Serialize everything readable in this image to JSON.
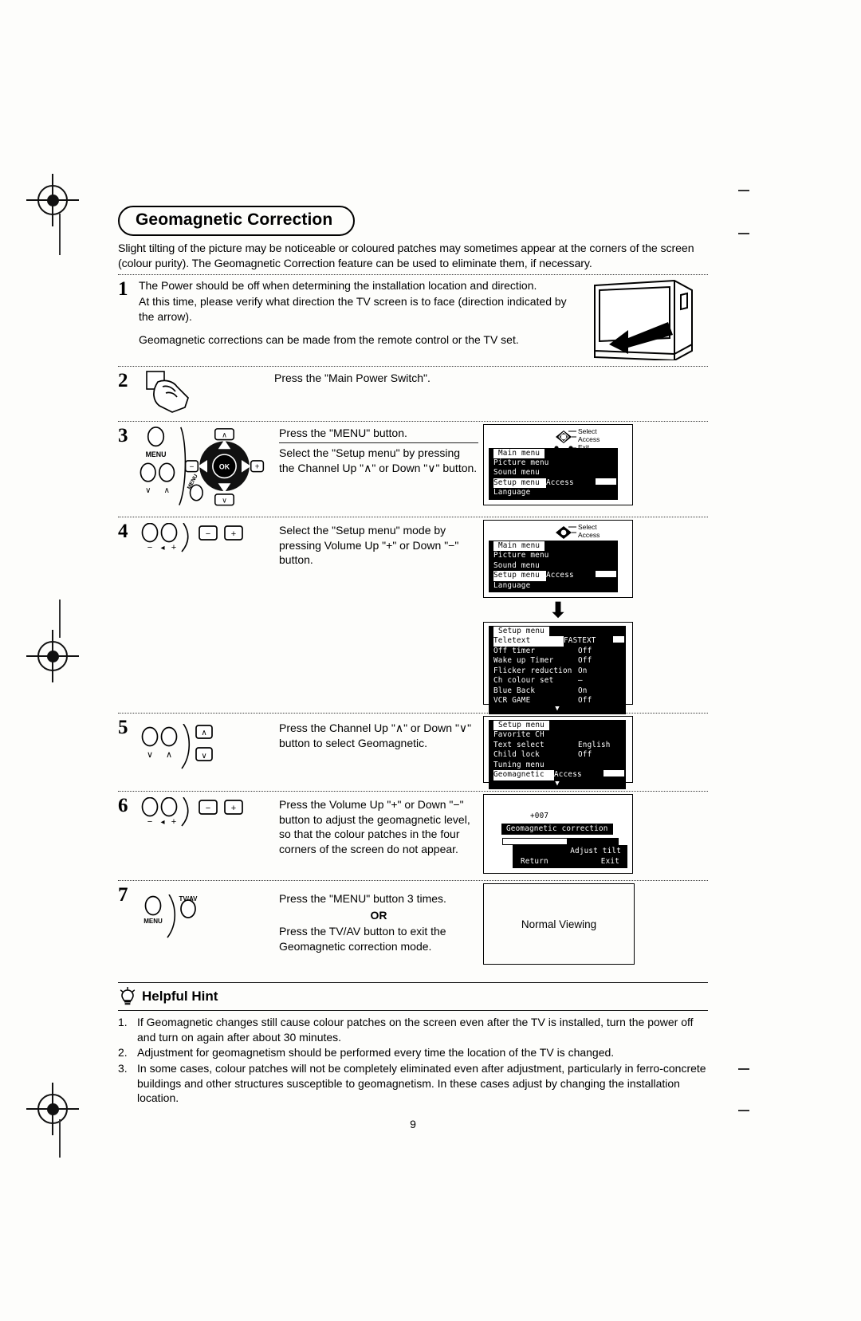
{
  "document": {
    "page_number": "9",
    "section_title": "Geomagnetic Correction",
    "intro": "Slight tilting of the picture may be noticeable or coloured patches may sometimes appear at the corners of the screen (colour purity). The Geomagnetic Correction feature can be used to eliminate them, if necessary."
  },
  "steps": [
    {
      "number": "1",
      "lines": [
        "The Power should be off when determining the installation location and direction.",
        "At this time, please verify what direction the TV screen is to face (direction indicated by the arrow).",
        "Geomagnetic corrections can be made from the remote control or the TV set."
      ],
      "art": "tv-set-with-direction-arrow"
    },
    {
      "number": "2",
      "text": "Press the \"Main Power Switch\".",
      "art": "hand-pressing-switch"
    },
    {
      "number": "3",
      "text_top": "Press the \"MENU\" button.",
      "text_bottom": "Select the \"Setup menu\" by pressing the Channel Up \"∧\" or Down \"∨\" button.",
      "art": "remote-menu-and-dpad",
      "remote_labels": {
        "menu": "MENU",
        "menu_small": "MENU",
        "ok": "OK",
        "minus": "−",
        "plus": "+",
        "up": "∧",
        "down": "∨"
      }
    },
    {
      "number": "4",
      "text": "Select the \"Setup menu\" mode by pressing Volume Up \"+\" or Down \"−\" button.",
      "art": "remote-volume-buttons"
    },
    {
      "number": "5",
      "text": "Press the Channel Up \"∧\" or Down \"∨\" button to select Geomagnetic.",
      "art": "remote-channel-buttons"
    },
    {
      "number": "6",
      "text": "Press the Volume Up \"+\" or Down \"−\" button to adjust the geomagnetic level, so that the colour patches in the four corners of the screen do not appear.",
      "art": "remote-volume-buttons"
    },
    {
      "number": "7",
      "text_top": "Press the \"MENU\" button 3 times.",
      "text_or": "OR",
      "text_bottom": "Press the TV/AV button to exit the Geomagnetic correction mode.",
      "art": "remote-menu-tvav",
      "remote_labels": {
        "menu": "MENU",
        "tvav": "TV/AV"
      }
    }
  ],
  "osd": {
    "legend": {
      "select": "Select",
      "access": "Access",
      "exit": "Exit"
    },
    "main_menu": {
      "title": "Main menu",
      "items": [
        {
          "label": "Picture menu",
          "value": ""
        },
        {
          "label": "Sound menu",
          "value": ""
        },
        {
          "label": "Setup menu",
          "value": "Access",
          "selected": true
        },
        {
          "label": "Language",
          "value": ""
        }
      ]
    },
    "setup_menu_detail": {
      "title": "Setup menu",
      "items": [
        {
          "label": "Teletext",
          "value": "FASTEXT",
          "selected": true
        },
        {
          "label": "Off timer",
          "value": "Off"
        },
        {
          "label": "Wake up Timer",
          "value": "Off"
        },
        {
          "label": "Flicker reduction",
          "value": "On"
        },
        {
          "label": "Ch colour set",
          "value": "—"
        },
        {
          "label": "Blue Back",
          "value": "On"
        },
        {
          "label": "VCR GAME",
          "value": "Off"
        }
      ],
      "more_indicator": "▼"
    },
    "setup_menu_geomagnetic": {
      "title": "Setup menu",
      "items": [
        {
          "label": "Favorite CH",
          "value": ""
        },
        {
          "label": "Text select",
          "value": "English"
        },
        {
          "label": "Child lock",
          "value": "Off"
        },
        {
          "label": "Tuning menu",
          "value": ""
        },
        {
          "label": "Geomagnetic",
          "value": "Access",
          "selected": true
        }
      ],
      "more_indicator": "▼"
    },
    "geomagnetic_adjust": {
      "value": "+007",
      "title": "Geomagnetic correction",
      "level_percent": 55,
      "footer_left": "Return",
      "footer_mid": "Exit",
      "footer_right": "Adjust tilt"
    },
    "normal_viewing": "Normal Viewing"
  },
  "helpful_hint": {
    "heading": "Helpful Hint",
    "icon": "lightbulb-icon",
    "items": [
      {
        "index": "1.",
        "text": "If Geomagnetic changes still cause colour patches on the screen even after the TV is installed, turn the power off and turn on again after about 30 minutes."
      },
      {
        "index": "2.",
        "text": "Adjustment for geomagnetism should be performed every time the location of the TV is changed."
      },
      {
        "index": "3.",
        "text": "In some cases, colour patches will not be completely eliminated even after adjustment, particularly in ferro-concrete buildings and other structures susceptible to geomagnetism. In these cases adjust by changing the installation location."
      }
    ]
  }
}
